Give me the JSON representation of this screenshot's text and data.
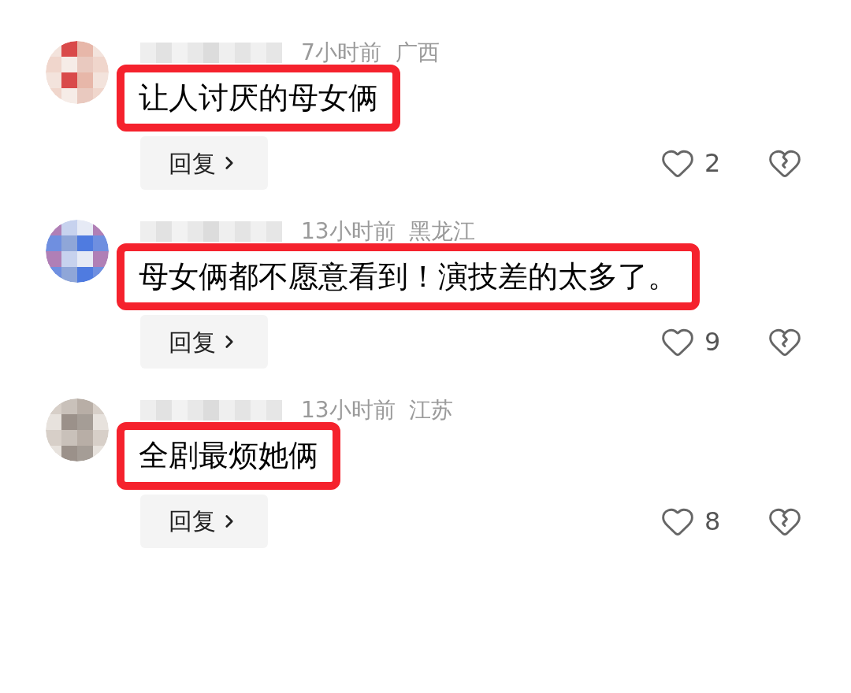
{
  "comments": [
    {
      "meta": "7小时前  广西",
      "text": "让人讨厌的母女俩",
      "reply": "回复",
      "likes": "2"
    },
    {
      "meta": "13小时前  黑龙江",
      "text": "母女俩都不愿意看到！演技差的太多了。",
      "reply": "回复",
      "likes": "9"
    },
    {
      "meta": "13小时前  江苏",
      "text": "全剧最烦她俩",
      "reply": "回复",
      "likes": "8"
    }
  ]
}
